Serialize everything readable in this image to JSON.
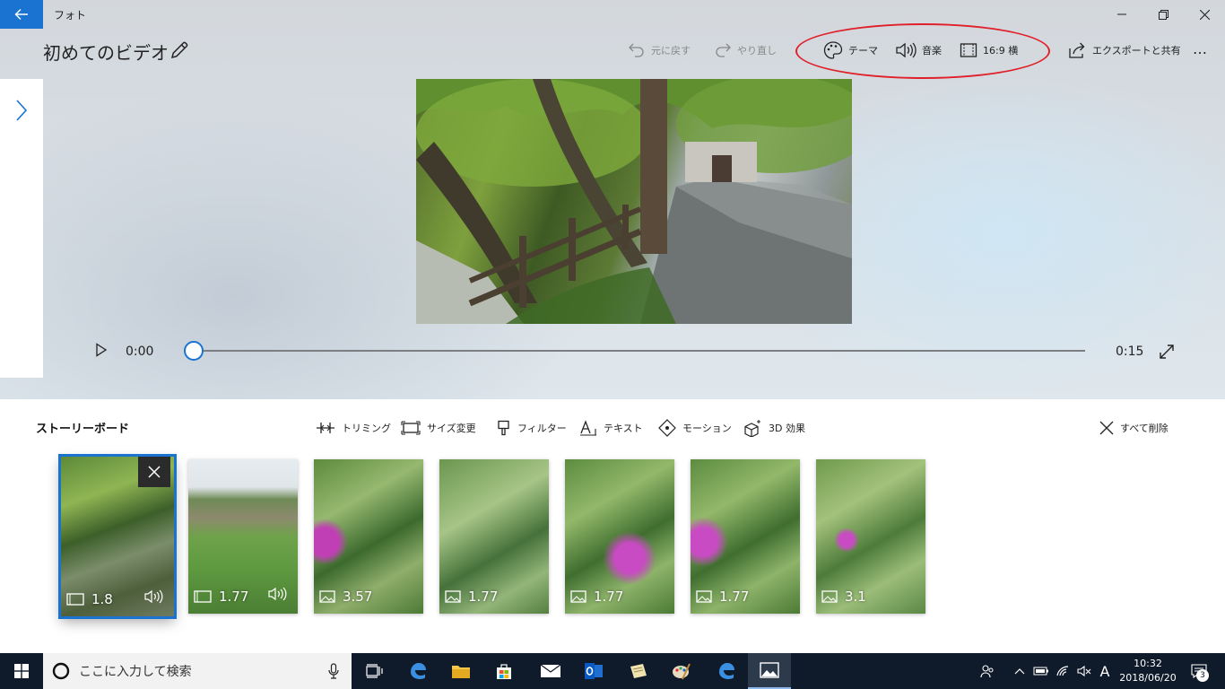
{
  "app": {
    "name": "フォト",
    "back_icon": "back-arrow-icon",
    "window_controls": [
      "minimize",
      "restore",
      "close"
    ]
  },
  "project": {
    "title": "初めてのビデオ",
    "edit_icon": "pencil-icon"
  },
  "toolbar": {
    "undo_label": "元に戻す",
    "redo_label": "やり直し",
    "theme_label": "テーマ",
    "music_label": "音楽",
    "aspect_label": "16:9 横",
    "export_label": "エクスポートと共有",
    "more_label": "…"
  },
  "player": {
    "current_time": "0:00",
    "total_time": "0:15",
    "progress": 0
  },
  "storyboard": {
    "title": "ストーリーボード",
    "tools": {
      "trim": "トリミング",
      "resize": "サイズ変更",
      "filter": "フィルター",
      "text": "テキスト",
      "motion": "モーション",
      "effects3d": "3D 効果"
    },
    "delete_all": "すべて削除",
    "clips": [
      {
        "duration": "1.8",
        "kind": "video",
        "has_audio": true,
        "selected": true
      },
      {
        "duration": "1.77",
        "kind": "video",
        "has_audio": true,
        "selected": false
      },
      {
        "duration": "3.57",
        "kind": "image",
        "has_audio": false,
        "selected": false
      },
      {
        "duration": "1.77",
        "kind": "image",
        "has_audio": false,
        "selected": false
      },
      {
        "duration": "1.77",
        "kind": "image",
        "has_audio": false,
        "selected": false
      },
      {
        "duration": "1.77",
        "kind": "image",
        "has_audio": false,
        "selected": false
      },
      {
        "duration": "3.1",
        "kind": "image",
        "has_audio": false,
        "selected": false
      }
    ]
  },
  "taskbar": {
    "search_placeholder": "ここに入力して検索",
    "ime": "A",
    "time": "10:32",
    "date": "2018/06/20",
    "notifications": "3"
  },
  "colors": {
    "accent": "#1a73d1",
    "annotation_ellipse": "#e0202a",
    "taskbar": "#0f1a2a"
  }
}
